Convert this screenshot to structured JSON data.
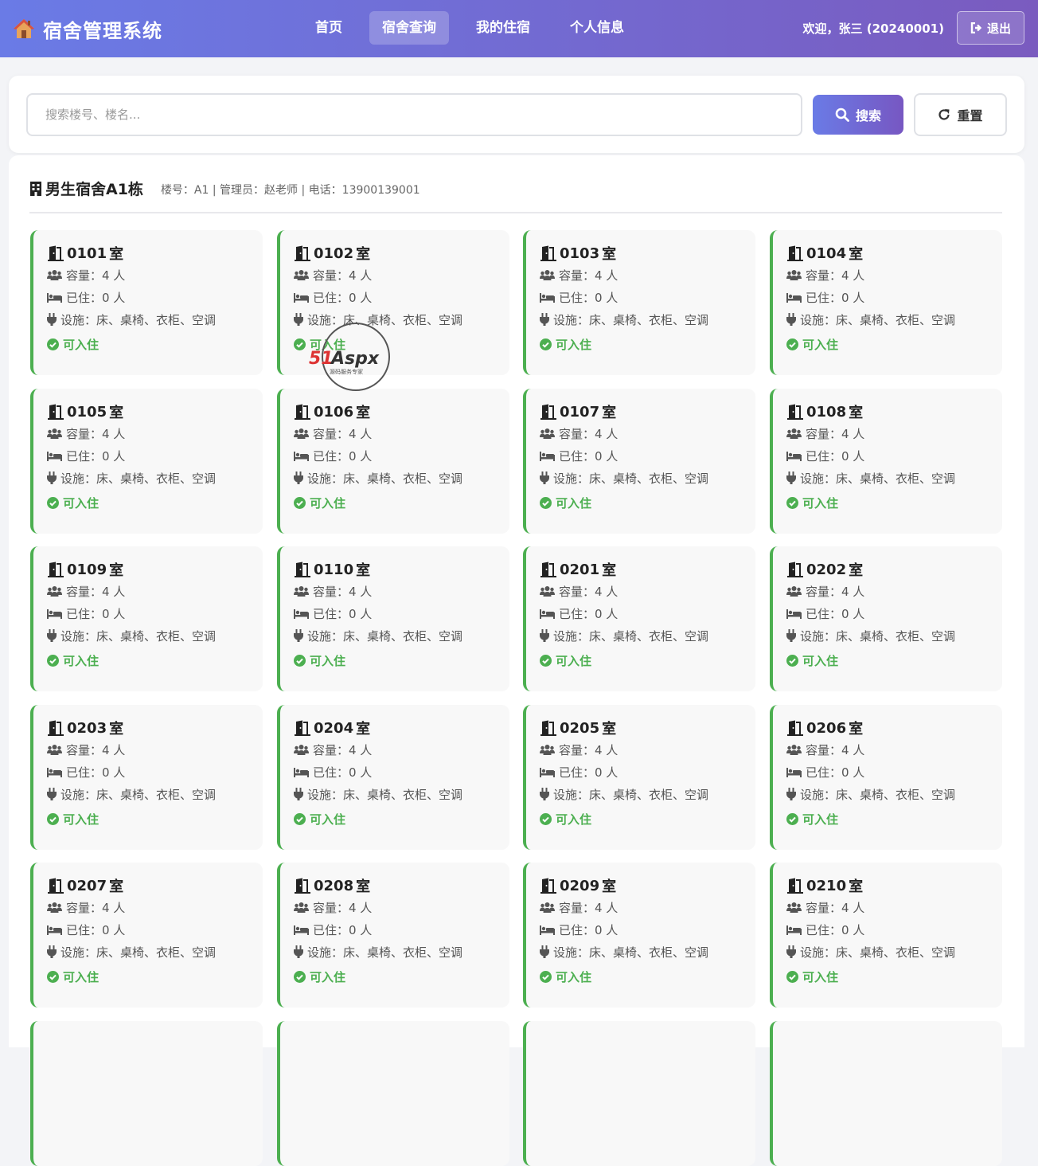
{
  "nav": {
    "brand": "宿舍管理系统",
    "links": [
      "首页",
      "宿舍查询",
      "我的住宿",
      "个人信息"
    ],
    "active_index": 1,
    "welcome": "欢迎，张三 (20240001)",
    "logout": "退出"
  },
  "search": {
    "placeholder": "搜索楼号、楼名...",
    "value": "",
    "search_label": "搜索",
    "reset_label": "重置"
  },
  "building": {
    "title": "男生宿舍A1栋",
    "meta": "楼号：A1 | 管理员：赵老师 | 电话：13900139001"
  },
  "room_labels": {
    "room_suffix": "室",
    "capacity": "容量：4 人",
    "occupied": "已住：0 人",
    "facilities": "设施：床、桌椅、衣柜、空调",
    "status": "可入住"
  },
  "rooms": [
    "0101",
    "0102",
    "0103",
    "0104",
    "0105",
    "0106",
    "0107",
    "0108",
    "0109",
    "0110",
    "0201",
    "0202",
    "0203",
    "0204",
    "0205",
    "0206",
    "0207",
    "0208",
    "0209",
    "0210"
  ],
  "watermark": {
    "brand": "51Aspx",
    "tagline": "源码服务专家"
  },
  "colors": {
    "accent": "#6a7be6",
    "accent2": "#7757c2",
    "available": "#4caf50"
  }
}
